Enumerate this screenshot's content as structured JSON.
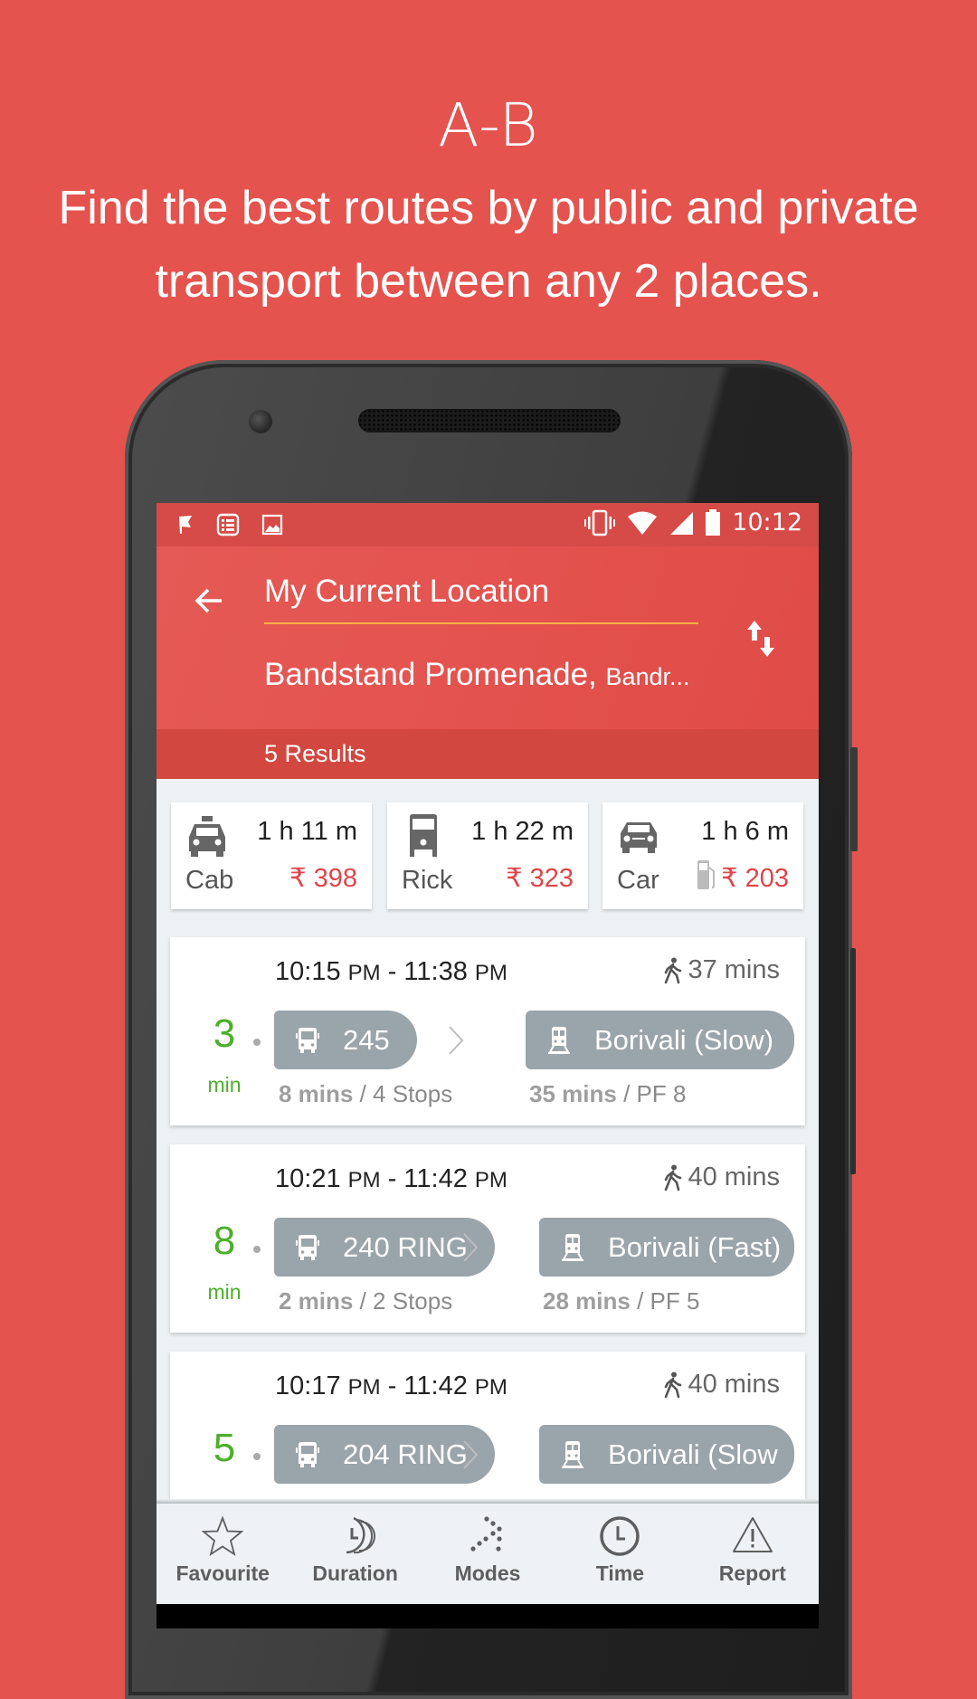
{
  "promo": {
    "title": "A-B",
    "subtitle": "Find the best routes by public and private transport between any 2 places."
  },
  "status_bar": {
    "time": "10:12",
    "left_icons": [
      "flag-icon",
      "list-notification-icon",
      "image-icon"
    ],
    "right_icons": [
      "vibrate-icon",
      "wifi-icon",
      "signal-icon",
      "battery-icon"
    ]
  },
  "search": {
    "from": "My Current Location",
    "to_main": "Bandstand Promenade,",
    "to_sub": "Bandr...",
    "swap_icon": "swap-vertical-icon",
    "back_icon": "arrow-left-icon"
  },
  "results": {
    "count_label": "5 Results"
  },
  "colors": {
    "brand": "#e5534f",
    "price": "#e0454a",
    "wait_green": "#4caf2a",
    "pill": "#9aa4ab",
    "accent_underline": "#f5b04a"
  },
  "quick_options": [
    {
      "mode": "Cab",
      "duration": "1 h 11 m",
      "price": "₹ 398",
      "icon": "taxi-icon"
    },
    {
      "mode": "Rick",
      "duration": "1 h 22 m",
      "price": "₹ 323",
      "icon": "auto-rickshaw-icon"
    },
    {
      "mode": "Car",
      "duration": "1 h 6 m",
      "price": "₹ 203",
      "icon": "car-icon",
      "extra_icon": "fuel-pump-icon"
    }
  ],
  "routes": [
    {
      "time_start": "10:15",
      "start_ampm": "PM",
      "time_end": "11:38",
      "end_ampm": "PM",
      "walk": "37 mins",
      "wait": "3",
      "wait_unit": "min",
      "bus": {
        "label": "245",
        "info_time": "8 mins",
        "info_detail": "/ 4 Stops"
      },
      "train": {
        "label": "Borivali  (Slow)",
        "info_time": "35 mins",
        "info_detail": "/ PF 8"
      }
    },
    {
      "time_start": "10:21",
      "start_ampm": "PM",
      "time_end": "11:42",
      "end_ampm": "PM",
      "walk": "40 mins",
      "wait": "8",
      "wait_unit": "min",
      "bus": {
        "label": "240 RING",
        "info_time": "2 mins",
        "info_detail": "/ 2 Stops"
      },
      "train": {
        "label": "Borivali  (Fast)",
        "info_time": "28 mins",
        "info_detail": "/ PF 5"
      }
    },
    {
      "time_start": "10:17",
      "start_ampm": "PM",
      "time_end": "11:42",
      "end_ampm": "PM",
      "walk": "40 mins",
      "wait": "5",
      "wait_unit": "",
      "bus": {
        "label": "204 RING",
        "info_time": "",
        "info_detail": ""
      },
      "train": {
        "label": "Borivali  (Slow",
        "info_time": "",
        "info_detail": ""
      }
    }
  ],
  "bottom_nav": [
    {
      "label": "Favourite",
      "icon": "star-icon"
    },
    {
      "label": "Duration",
      "icon": "duration-icon"
    },
    {
      "label": "Modes",
      "icon": "modes-icon"
    },
    {
      "label": "Time",
      "icon": "clock-icon"
    },
    {
      "label": "Report",
      "icon": "warning-icon"
    }
  ]
}
